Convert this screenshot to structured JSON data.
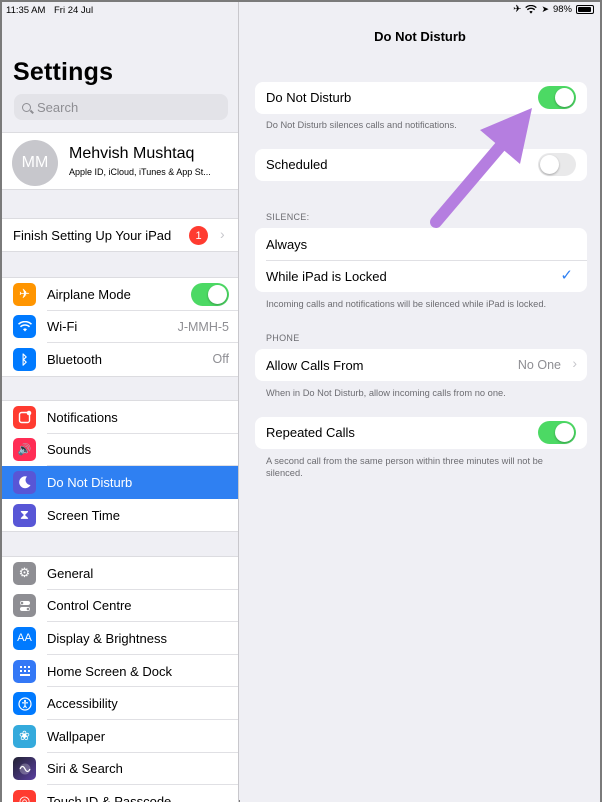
{
  "status": {
    "time": "11:35 AM",
    "date": "Fri 24 Jul",
    "battery": "98%"
  },
  "sidebar": {
    "title": "Settings",
    "search_placeholder": "Search",
    "profile": {
      "initials": "MM",
      "name": "Mehvish Mushtaq",
      "subtitle": "Apple ID, iCloud, iTunes & App St..."
    },
    "finish": {
      "label": "Finish Setting Up Your iPad",
      "badge": "1"
    },
    "group1": [
      {
        "label": "Airplane Mode",
        "icon": "airplane-icon",
        "color": "#ff9500",
        "value": "",
        "toggle": true
      },
      {
        "label": "Wi-Fi",
        "icon": "wifi-icon",
        "color": "#007aff",
        "value": "J-MMH-5"
      },
      {
        "label": "Bluetooth",
        "icon": "bluetooth-icon",
        "color": "#007aff",
        "value": "Off"
      }
    ],
    "group2": [
      {
        "label": "Notifications",
        "icon": "notifications-icon",
        "color": "#ff3b30"
      },
      {
        "label": "Sounds",
        "icon": "speaker-icon",
        "color": "#ff2d55"
      },
      {
        "label": "Do Not Disturb",
        "icon": "moon-icon",
        "color": "#5856d6",
        "selected": true
      },
      {
        "label": "Screen Time",
        "icon": "hourglass-icon",
        "color": "#5856d6"
      }
    ],
    "group3": [
      {
        "label": "General",
        "icon": "gear-icon",
        "color": "#8e8e93"
      },
      {
        "label": "Control Centre",
        "icon": "switches-icon",
        "color": "#8e8e93"
      },
      {
        "label": "Display & Brightness",
        "icon": "text-size-icon",
        "color": "#007aff"
      },
      {
        "label": "Home Screen & Dock",
        "icon": "home-grid-icon",
        "color": "#3478f6"
      },
      {
        "label": "Accessibility",
        "icon": "accessibility-icon",
        "color": "#007aff"
      },
      {
        "label": "Wallpaper",
        "icon": "flower-icon",
        "color": "#34aadc"
      },
      {
        "label": "Siri & Search",
        "icon": "siri-icon",
        "color": "#222233"
      },
      {
        "label": "Touch ID & Passcode",
        "icon": "fingerprint-icon",
        "color": "#ff3b30"
      }
    ]
  },
  "main": {
    "title": "Do Not Disturb",
    "dnd": {
      "label": "Do Not Disturb",
      "on": true,
      "footnote": "Do Not Disturb silences calls and notifications."
    },
    "scheduled": {
      "label": "Scheduled",
      "on": false
    },
    "silence_header": "SILENCE:",
    "silence_always": "Always",
    "silence_locked": "While iPad is Locked",
    "silence_footnote": "Incoming calls and notifications will be silenced while iPad is locked.",
    "phone_header": "PHONE",
    "allow_calls": {
      "label": "Allow Calls From",
      "value": "No One"
    },
    "allow_footnote": "When in Do Not Disturb, allow incoming calls from no one.",
    "repeated": {
      "label": "Repeated Calls",
      "on": true,
      "footnote": "A second call from the same person within three minutes will not be silenced."
    }
  },
  "colors": {
    "accent": "#2f80f2",
    "toggle_on": "#4cd964",
    "arrow": "#b57ee0"
  }
}
